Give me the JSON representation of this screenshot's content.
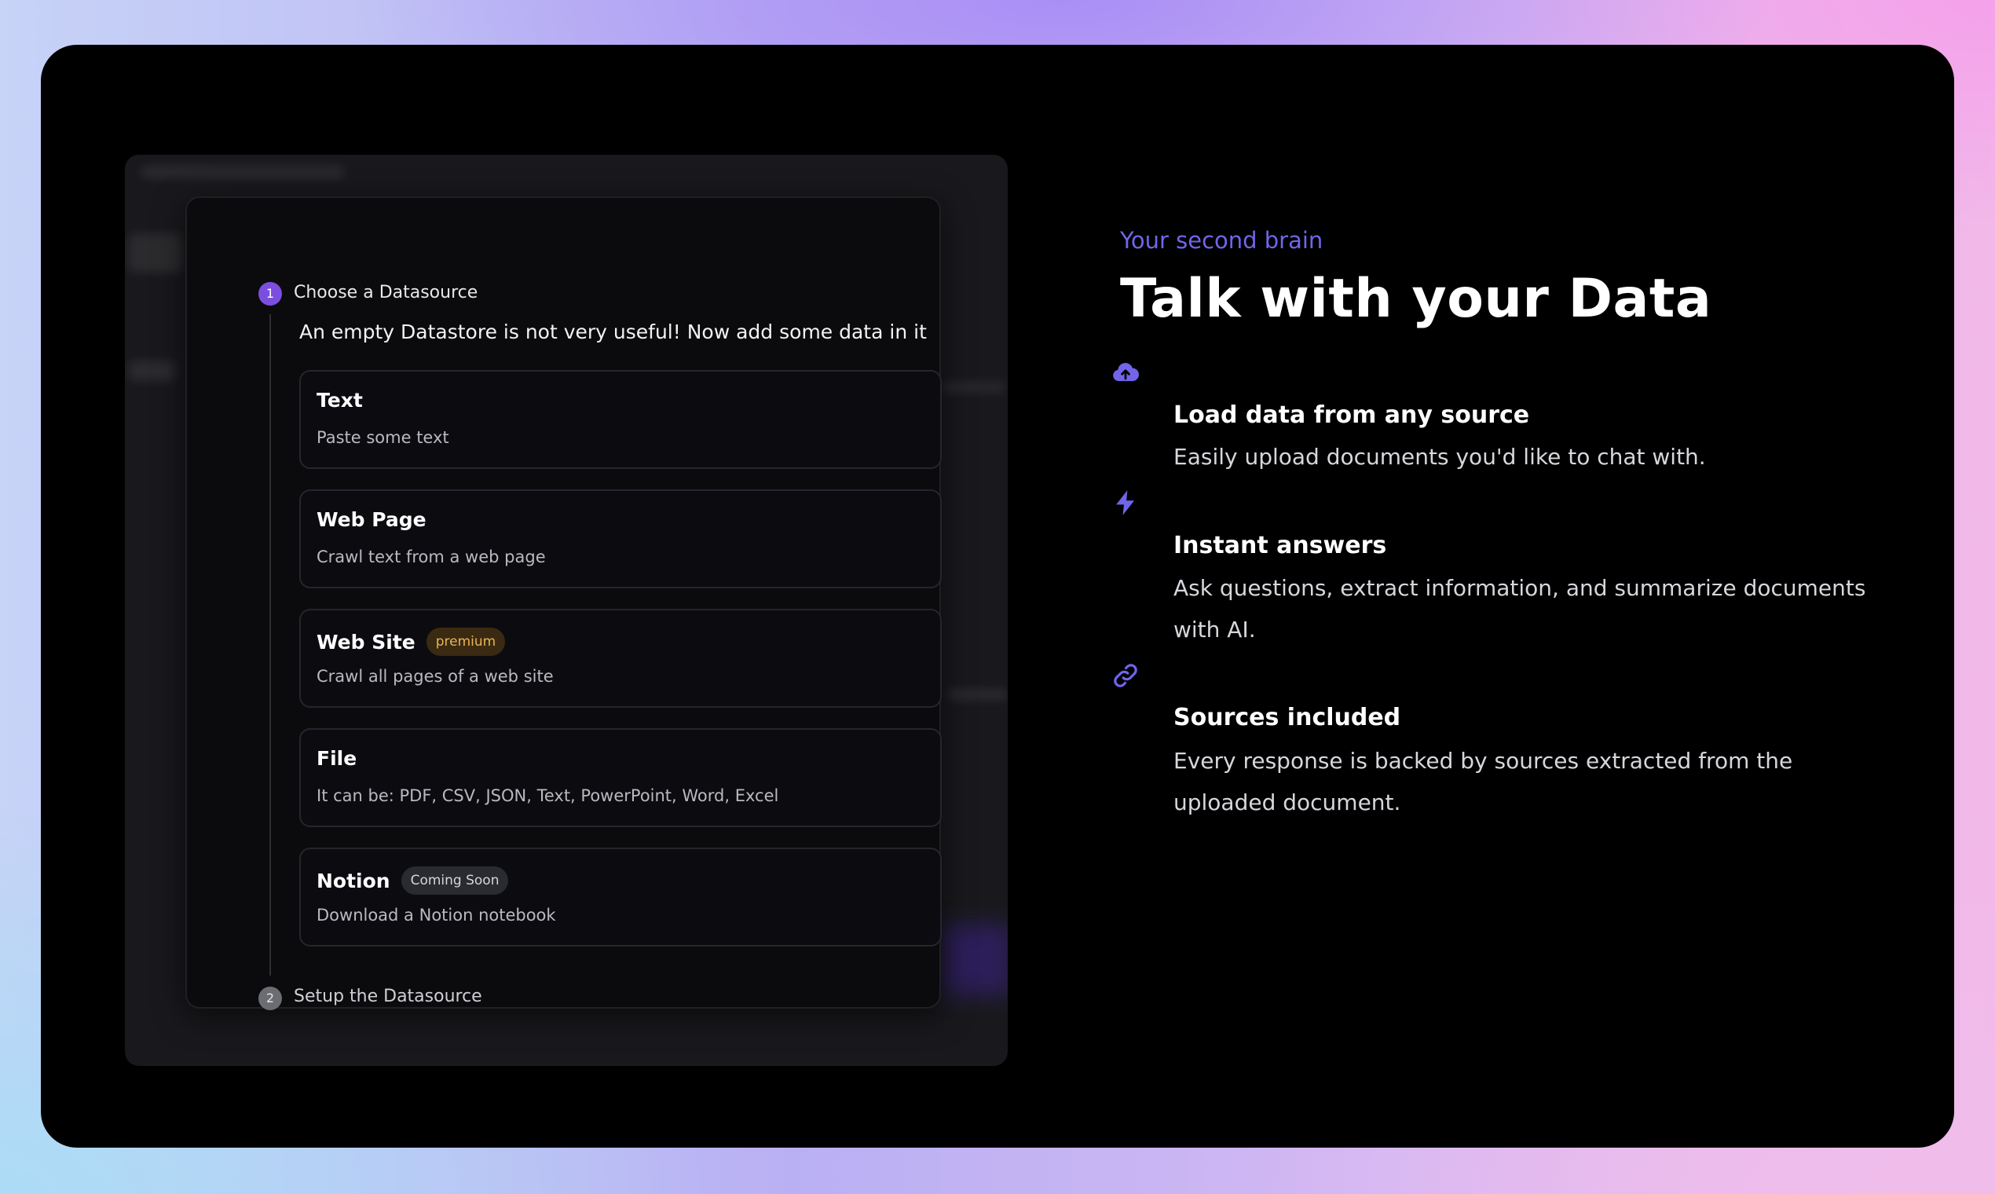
{
  "modal": {
    "step1": {
      "number": "1",
      "title": "Choose a Datasource"
    },
    "subtitle": "An empty Datastore is not very useful! Now add some data in it",
    "options": [
      {
        "title": "Text",
        "description": "Paste some text"
      },
      {
        "title": "Web Page",
        "description": "Crawl text from a web page"
      },
      {
        "title": "Web Site",
        "badge": "premium",
        "description": "Crawl all pages of a web site"
      },
      {
        "title": "File",
        "description": "It can be: PDF, CSV, JSON, Text, PowerPoint, Word, Excel"
      },
      {
        "title": "Notion",
        "badge": "Coming Soon",
        "description": "Download a Notion notebook"
      }
    ],
    "step2": {
      "number": "2",
      "title": "Setup the Datasource"
    }
  },
  "hero": {
    "eyebrow": "Your second brain",
    "headline": "Talk with your Data"
  },
  "features": [
    {
      "icon": "cloud-upload-icon",
      "title": "Load data from any source",
      "description": "Easily upload documents you'd like to chat with."
    },
    {
      "icon": "lightning-bolt-icon",
      "title": "Instant answers",
      "description": "Ask questions, extract information, and summarize documents with AI."
    },
    {
      "icon": "link-icon",
      "title": "Sources included",
      "description": "Every response is backed by sources extracted from the uploaded document."
    }
  ],
  "colors": {
    "accent": "#7165ea",
    "step_active": "#7c4ee0",
    "premium_text": "#e9b454",
    "card_background": "#000000"
  }
}
